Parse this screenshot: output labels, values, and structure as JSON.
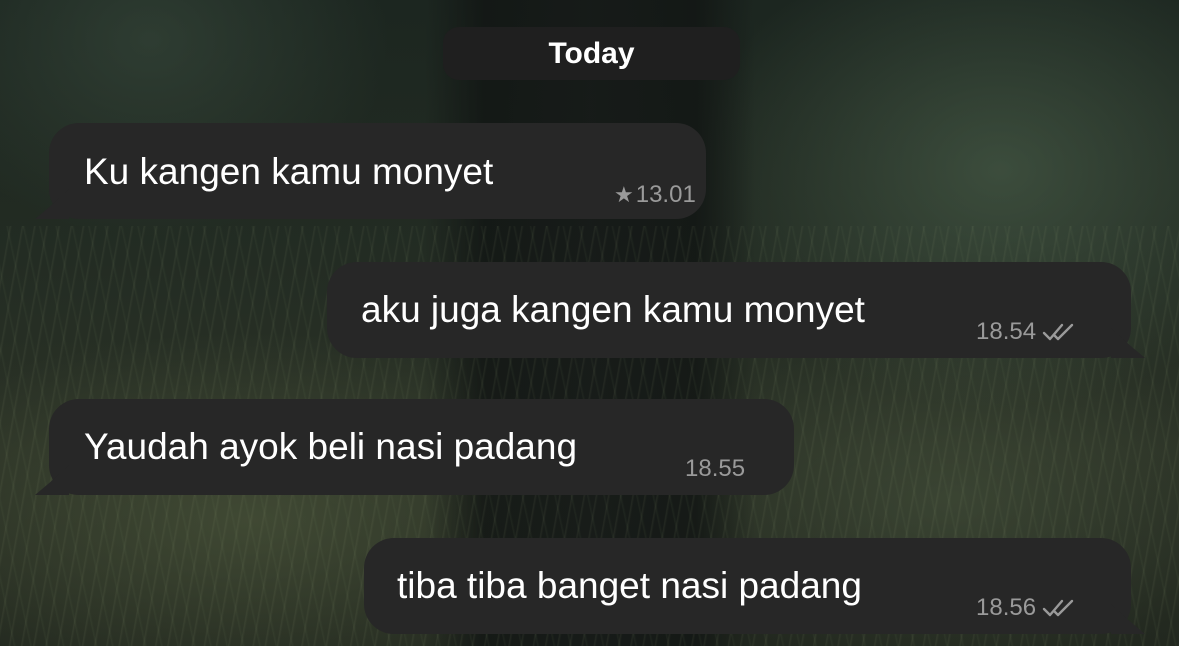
{
  "date_divider": "Today",
  "messages": [
    {
      "direction": "incoming",
      "text": "Ku kangen kamu monyet",
      "time": "13.01",
      "starred": true,
      "status_icon": "star-icon"
    },
    {
      "direction": "outgoing",
      "text": "aku juga kangen kamu monyet",
      "time": "18.54",
      "status_icon": "double-check-icon"
    },
    {
      "direction": "incoming",
      "text": "Yaudah ayok beli nasi padang",
      "time": "18.55"
    },
    {
      "direction": "outgoing",
      "text": "tiba tiba banget nasi padang",
      "time": "18.56",
      "status_icon": "double-check-icon"
    }
  ],
  "colors": {
    "bubble": "#272727",
    "date_pill": "#1f1f1f",
    "timestamp": "#9a9a9a",
    "text": "#ffffff"
  }
}
